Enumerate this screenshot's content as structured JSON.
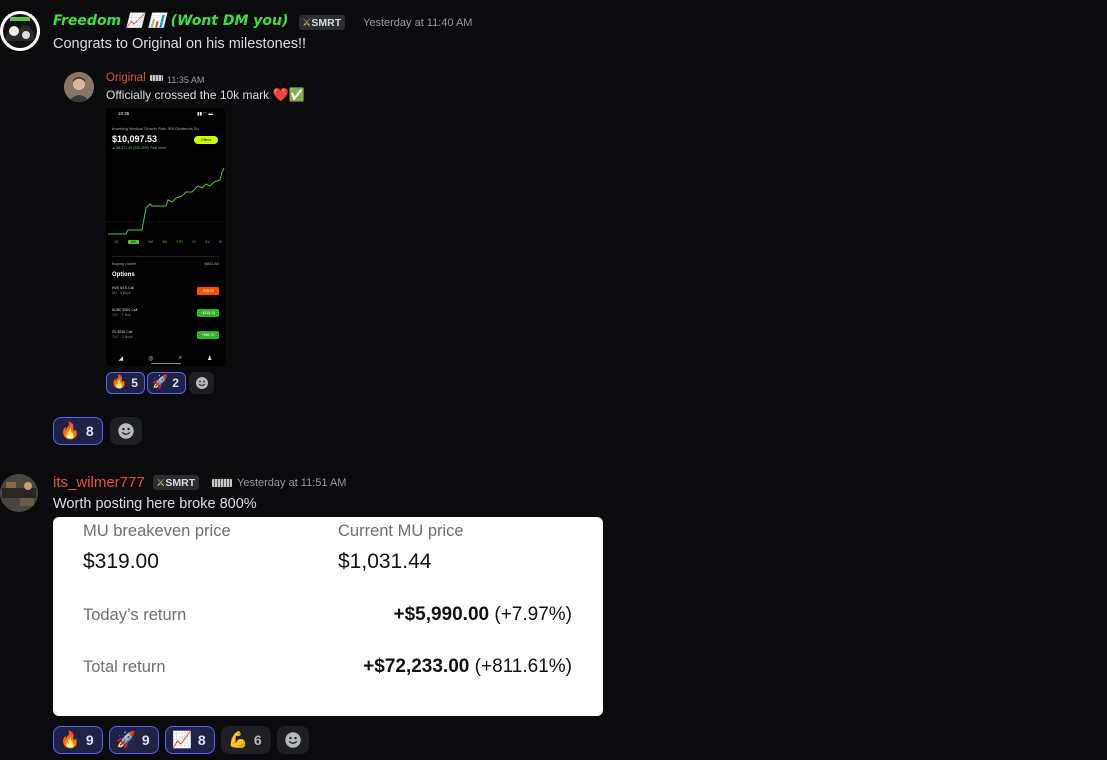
{
  "messages": [
    {
      "username": "Freedom 📈 📊 (Wont DM you)",
      "username_color": "#3ee03e",
      "tag": "SMRT",
      "time": "Yesterday at 11:40 AM",
      "text": "Congrats to Original on his milestones!!",
      "forwarded": {
        "username": "Original",
        "username_color": "#e8513a",
        "time": "11:35 AM",
        "text": "Officially crossed the 10k mark",
        "text_emoji": "❤️✅",
        "phone": {
          "status_time": "10:35",
          "tabs": "Investing   Medical Growth   Roth IRA   Dividends   Su",
          "balance": "$10,097.53",
          "gain_text": "▲ $8,071.49 (398.38%) Past week",
          "offers_label": "Offers",
          "ranges": [
            "1D",
            "1W",
            "1M",
            "3M",
            "YTD",
            "1Y",
            "5Y",
            "⚙"
          ],
          "active_range": "1W",
          "buying_power_label": "Buying power",
          "buying_power_value": "$843.84",
          "options_label": "Options",
          "options": [
            {
              "name": "HVE $4.5 Call",
              "sub": "8/2 · 9 Buys",
              "value": "-$45.00",
              "color": "#ff5000"
            },
            {
              "name": "ADBE $350 Call",
              "sub": "7/17 · 1 Buy",
              "value": "+$118.23",
              "color": "#2cb52c"
            },
            {
              "name": "ZS $330 Call",
              "sub": "7/17 · 3 Buys",
              "value": "+$88.70",
              "color": "#2cb52c"
            }
          ],
          "nav_icons": [
            "chart-icon",
            "browse-icon",
            "search-icon",
            "account-icon"
          ]
        },
        "reactions": [
          {
            "emoji": "🔥",
            "count": "5",
            "highlighted": true
          },
          {
            "emoji": "🚀",
            "count": "2",
            "highlighted": true
          }
        ]
      },
      "reactions": [
        {
          "emoji": "🔥",
          "count": "8",
          "highlighted": true
        }
      ]
    },
    {
      "username": "its_wilmer777",
      "username_color": "#e8513a",
      "tag": "SMRT",
      "time": "Yesterday at 11:51 AM",
      "text": "Worth posting here broke 800%",
      "card": {
        "breakeven_label": "MU breakeven price",
        "breakeven_value": "$319.00",
        "current_label": "Current MU price",
        "current_value": "$1,031.44",
        "today_label": "Today’s return",
        "today_value": "+$5,990.00",
        "today_pct": "(+7.97%)",
        "total_label": "Total return",
        "total_value": "+$72,233.00",
        "total_pct": "(+811.61%)"
      },
      "reactions": [
        {
          "emoji": "🔥",
          "count": "9",
          "highlighted": true
        },
        {
          "emoji": "🚀",
          "count": "9",
          "highlighted": true
        },
        {
          "emoji": "📈",
          "count": "8",
          "highlighted": true
        },
        {
          "emoji": "💪",
          "count": "6",
          "highlighted": false
        }
      ]
    }
  ]
}
